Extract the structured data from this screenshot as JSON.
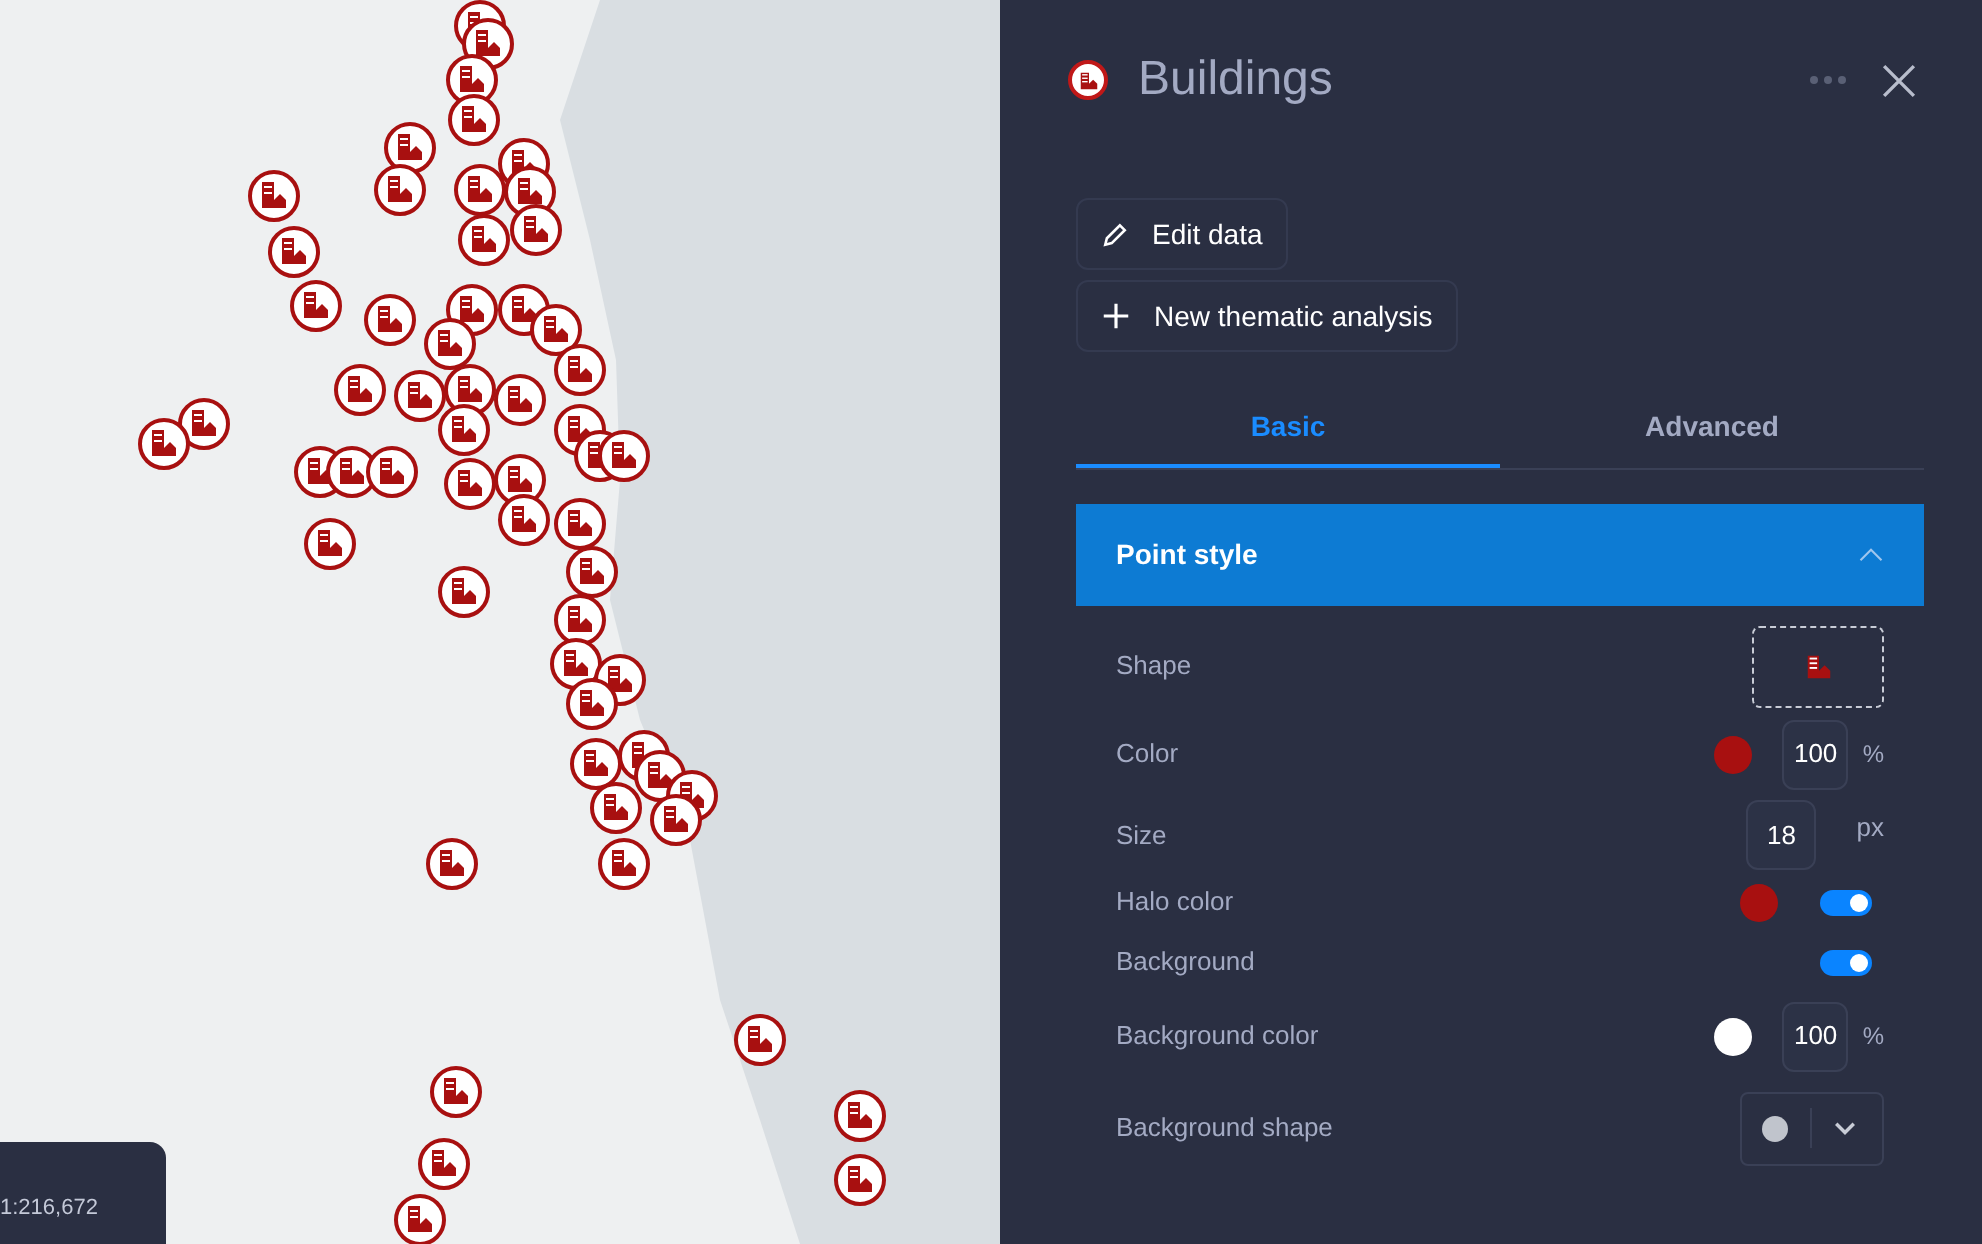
{
  "map": {
    "scale": "1:216,672"
  },
  "panel": {
    "title": "Buildings",
    "actions": [
      {
        "kind": "edit",
        "label": "Edit data"
      },
      {
        "kind": "add",
        "label": "New thematic analysis"
      }
    ],
    "tabs": [
      {
        "label": "Basic",
        "selected": true
      },
      {
        "label": "Advanced",
        "selected": false
      }
    ],
    "section": {
      "title": "Point style",
      "expanded": true
    },
    "rows": [
      {
        "kind": "shape",
        "label": "Shape"
      },
      {
        "kind": "color_opacity",
        "label": "Color",
        "color": "#a81010",
        "opacity": "100",
        "unit": "%"
      },
      {
        "kind": "size",
        "label": "Size",
        "value": "18",
        "unit": "px"
      },
      {
        "kind": "color_toggle",
        "label": "Halo color",
        "color": "#a81010",
        "on": true
      },
      {
        "kind": "toggle",
        "label": "Background",
        "on": true
      },
      {
        "kind": "color_opacity",
        "label": "Background color",
        "color": "#ffffff",
        "opacity": "100",
        "unit": "%"
      },
      {
        "kind": "dropdown",
        "label": "Background shape"
      }
    ]
  }
}
